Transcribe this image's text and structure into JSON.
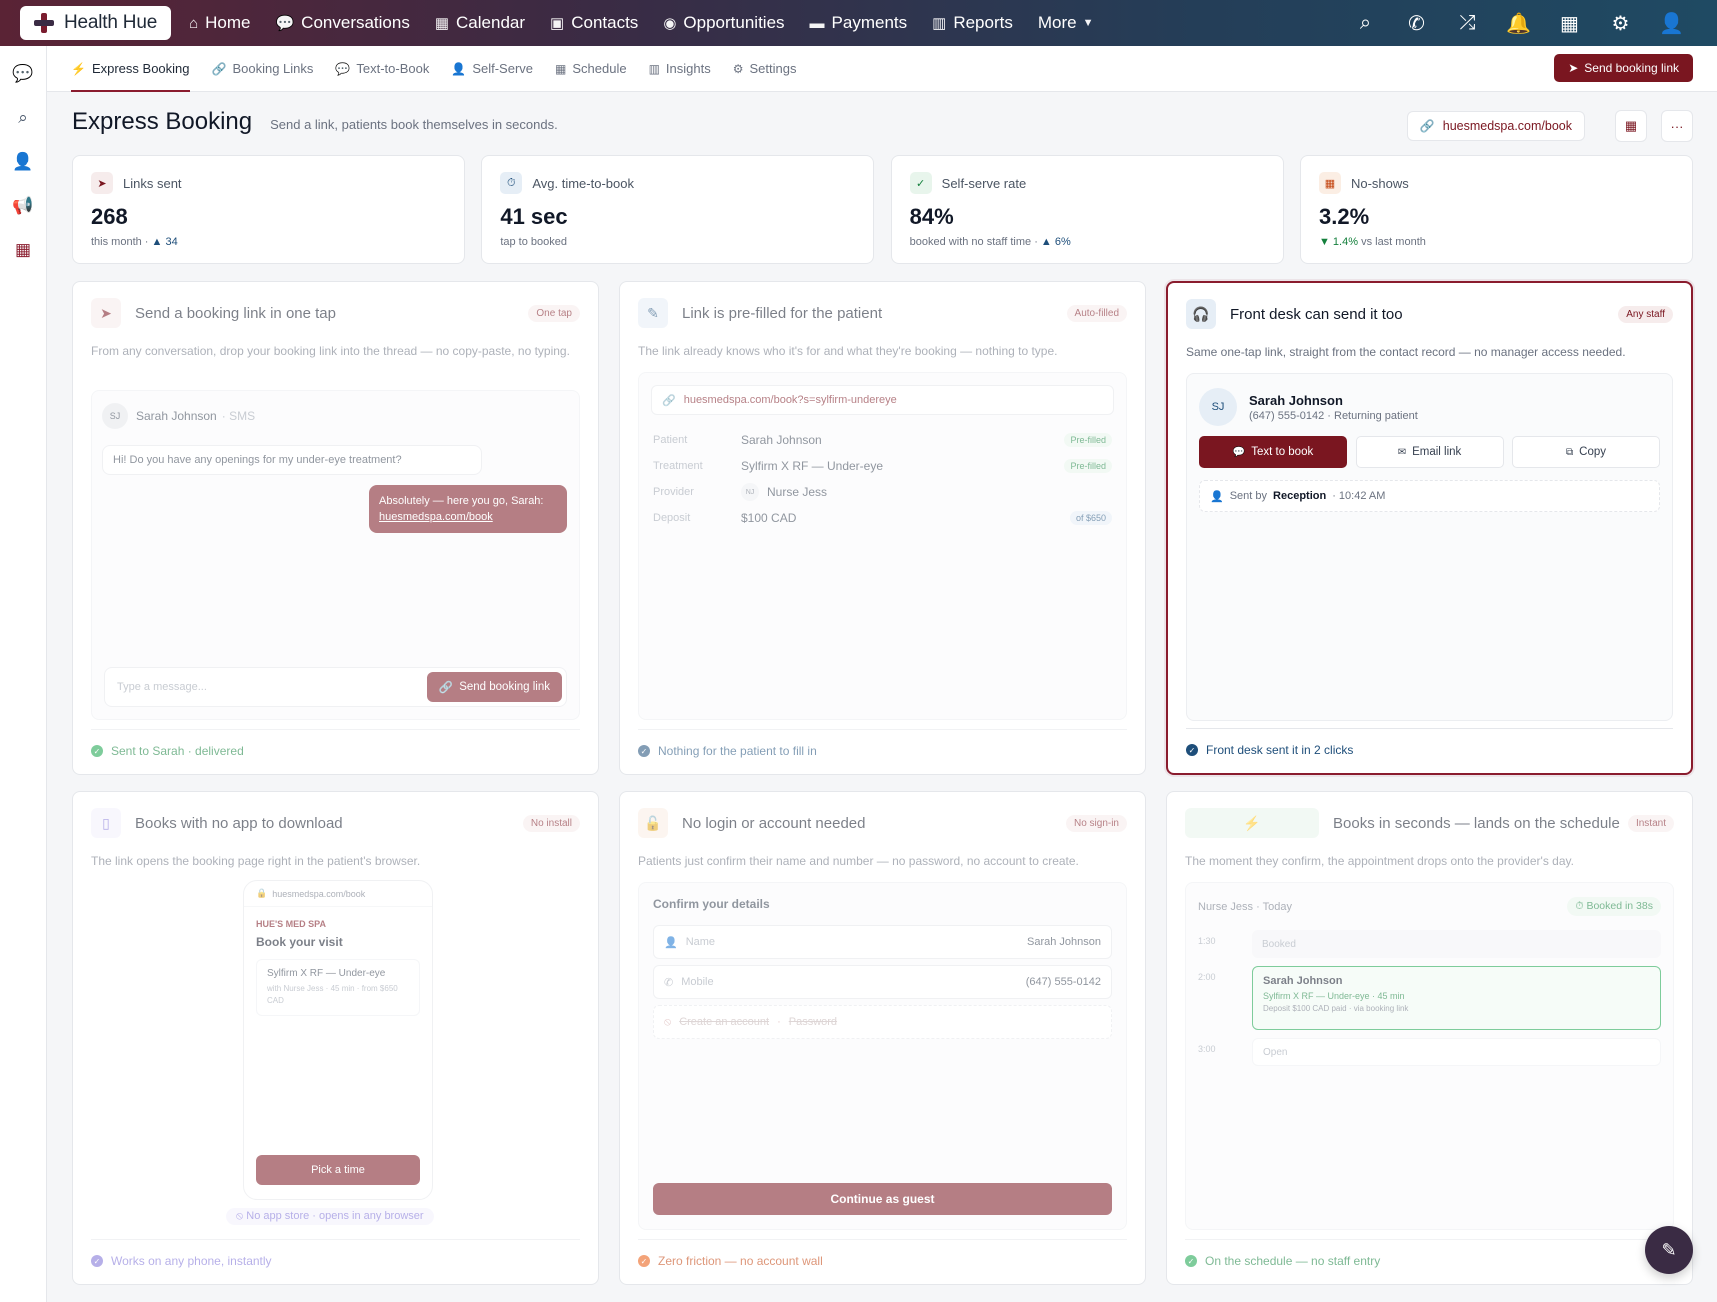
{
  "app": {
    "name": "Health Hue"
  },
  "nav": [
    {
      "label": "Home",
      "icon": "home-icon"
    },
    {
      "label": "Conversations",
      "icon": "chat-icon"
    },
    {
      "label": "Calendar",
      "icon": "calendar-icon"
    },
    {
      "label": "Contacts",
      "icon": "contacts-icon"
    },
    {
      "label": "Opportunities",
      "icon": "lightbulb-icon"
    },
    {
      "label": "Payments",
      "icon": "card-icon"
    },
    {
      "label": "Reports",
      "icon": "bar-chart-icon"
    },
    {
      "label": "More",
      "icon": "chevron-down-icon"
    }
  ],
  "subnav": {
    "tabs": [
      "Express Booking",
      "Booking Links",
      "Text-to-Book",
      "Self-Serve",
      "Schedule",
      "Insights",
      "Settings"
    ],
    "send_button": "Send booking link"
  },
  "page": {
    "title": "Express Booking",
    "subtitle": "Send a link, patients book themselves in seconds.",
    "url": "huesmedspa.com/book"
  },
  "kpis": [
    {
      "label": "Links sent",
      "value": "268",
      "foot": "this month ·",
      "delta": "▲ 34"
    },
    {
      "label": "Avg. time-to-book",
      "value": "41 sec",
      "foot": "tap to booked",
      "delta": ""
    },
    {
      "label": "Self-serve rate",
      "value": "84%",
      "foot": "booked with no staff time ·",
      "delta": "▲ 6%"
    },
    {
      "label": "No-shows",
      "value": "3.2%",
      "foot": "vs last month",
      "delta": "▼ 1.4%"
    }
  ],
  "cards": {
    "send": {
      "title": "Send a booking link in one tap",
      "tag": "One tap",
      "desc": "From any conversation, drop your booking link into the thread — no copy-paste, no typing.",
      "contact_initials": "SJ",
      "contact_name": "Sarah Johnson",
      "channel": "· SMS",
      "msg_in": "Hi! Do you have any openings for my under-eye treatment?",
      "msg_out": "Absolutely — here you go, Sarah:",
      "msg_link": "huesmedspa.com/book",
      "composer_placeholder": "Type a message...",
      "composer_button": "Send booking link",
      "footer": "Sent to Sarah · delivered"
    },
    "prefill": {
      "title": "Link is pre-filled for the patient",
      "tag": "Auto-filled",
      "desc": "The link already knows who it's for and what they're booking — nothing to type.",
      "url": "huesmedspa.com/book?s=sylfirm-undereye",
      "rows": [
        {
          "k": "Patient",
          "v": "Sarah Johnson",
          "pill": "Pre-filled"
        },
        {
          "k": "Treatment",
          "v": "Sylfirm X RF — Under-eye",
          "pill": "Pre-filled"
        },
        {
          "k": "Provider",
          "v": "Nurse Jess",
          "pill": ""
        },
        {
          "k": "Deposit",
          "v": "$100 CAD",
          "pill": "of $650"
        }
      ],
      "provider_initials": "NJ",
      "footer": "Nothing for the patient to fill in"
    },
    "frontdesk": {
      "title": "Front desk can send it too",
      "tag": "Any staff",
      "desc": "Same one-tap link, straight from the contact record — no manager access needed.",
      "initials": "SJ",
      "name": "Sarah Johnson",
      "phone": "(647) 555-0142 · Returning patient",
      "actions": [
        "Text to book",
        "Email link",
        "Copy"
      ],
      "sent_prefix": "Sent by",
      "sent_by": "Reception",
      "sent_time": "· 10:42 AM",
      "footer": "Front desk sent it in 2 clicks"
    },
    "noapp": {
      "title": "Books with no app to download",
      "tag": "No install",
      "desc": "The link opens the booking page right in the patient's browser.",
      "phone_url": "huesmedspa.com/book",
      "brand": "HUE'S MED SPA",
      "book_title": "Book your visit",
      "svc": "Sylfirm X RF — Under-eye",
      "svc_detail": "with Nurse Jess · 45 min · from $650 CAD",
      "pick": "Pick a time",
      "badge": "No app store · opens in any browser",
      "footer": "Works on any phone, instantly"
    },
    "nologin": {
      "title": "No login or account needed",
      "tag": "No sign-in",
      "desc": "Patients just confirm their name and number — no password, no account to create.",
      "form_title": "Confirm your details",
      "name_label": "Name",
      "name_value": "Sarah Johnson",
      "mobile_label": "Mobile",
      "mobile_value": "(647) 555-0142",
      "create": "Create an account",
      "password": "Password",
      "button": "Continue as guest",
      "footer": "Zero friction — no account wall"
    },
    "seconds": {
      "title": "Books in seconds — lands on the schedule",
      "tag": "Instant",
      "desc": "The moment they confirm, the appointment drops onto the provider's day.",
      "day": "Nurse Jess · Today",
      "booked_badge": "Booked in 38s",
      "t1": "1:30",
      "s1": "Booked",
      "t2": "2:00",
      "appt_name": "Sarah Johnson",
      "appt_svc": "Sylfirm X RF — Under-eye · 45 min",
      "appt_dep": "Deposit $100 CAD paid · via booking link",
      "t3": "3:00",
      "s3": "Open",
      "footer": "On the schedule — no staff entry"
    }
  },
  "colors": {
    "brand": "#7a1620",
    "accent": "#8a1c2e",
    "success": "#15803d"
  }
}
